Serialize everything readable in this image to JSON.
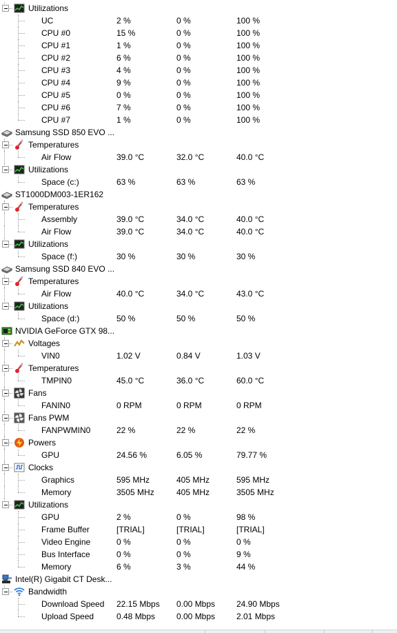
{
  "tree": [
    {
      "level": 1,
      "icon": "utilization-icon",
      "label": "Utilizations"
    },
    {
      "level": 2,
      "label": "UC",
      "values": [
        "2 %",
        "0 %",
        "100 %"
      ]
    },
    {
      "level": 2,
      "label": "CPU #0",
      "values": [
        "15 %",
        "0 %",
        "100 %"
      ]
    },
    {
      "level": 2,
      "label": "CPU #1",
      "values": [
        "1 %",
        "0 %",
        "100 %"
      ]
    },
    {
      "level": 2,
      "label": "CPU #2",
      "values": [
        "6 %",
        "0 %",
        "100 %"
      ]
    },
    {
      "level": 2,
      "label": "CPU #3",
      "values": [
        "4 %",
        "0 %",
        "100 %"
      ]
    },
    {
      "level": 2,
      "label": "CPU #4",
      "values": [
        "9 %",
        "0 %",
        "100 %"
      ]
    },
    {
      "level": 2,
      "label": "CPU #5",
      "values": [
        "0 %",
        "0 %",
        "100 %"
      ]
    },
    {
      "level": 2,
      "label": "CPU #6",
      "values": [
        "7 %",
        "0 %",
        "100 %"
      ]
    },
    {
      "level": 2,
      "label": "CPU #7",
      "values": [
        "1 %",
        "0 %",
        "100 %"
      ]
    },
    {
      "level": 0,
      "icon": "drive-icon",
      "label": "Samsung SSD 850 EVO ..."
    },
    {
      "level": 1,
      "icon": "thermometer-icon",
      "label": "Temperatures"
    },
    {
      "level": 2,
      "label": "Air Flow",
      "values": [
        "39.0 °C",
        "32.0 °C",
        "40.0 °C"
      ]
    },
    {
      "level": 1,
      "icon": "utilization-icon",
      "label": "Utilizations"
    },
    {
      "level": 2,
      "label": "Space (c:)",
      "values": [
        "63 %",
        "63 %",
        "63 %"
      ]
    },
    {
      "level": 0,
      "icon": "drive-icon",
      "label": "ST1000DM003-1ER162"
    },
    {
      "level": 1,
      "icon": "thermometer-icon",
      "label": "Temperatures"
    },
    {
      "level": 2,
      "label": "Assembly",
      "values": [
        "39.0 °C",
        "34.0 °C",
        "40.0 °C"
      ]
    },
    {
      "level": 2,
      "label": "Air Flow",
      "values": [
        "39.0 °C",
        "34.0 °C",
        "40.0 °C"
      ]
    },
    {
      "level": 1,
      "icon": "utilization-icon",
      "label": "Utilizations"
    },
    {
      "level": 2,
      "label": "Space (f:)",
      "values": [
        "30 %",
        "30 %",
        "30 %"
      ]
    },
    {
      "level": 0,
      "icon": "drive-icon",
      "label": "Samsung SSD 840 EVO ..."
    },
    {
      "level": 1,
      "icon": "thermometer-icon",
      "label": "Temperatures"
    },
    {
      "level": 2,
      "label": "Air Flow",
      "values": [
        "40.0 °C",
        "34.0 °C",
        "43.0 °C"
      ]
    },
    {
      "level": 1,
      "icon": "utilization-icon",
      "label": "Utilizations"
    },
    {
      "level": 2,
      "label": "Space (d:)",
      "values": [
        "50 %",
        "50 %",
        "50 %"
      ]
    },
    {
      "level": 0,
      "icon": "gpu-icon",
      "label": "NVIDIA GeForce GTX 98..."
    },
    {
      "level": 1,
      "icon": "voltage-icon",
      "label": "Voltages"
    },
    {
      "level": 2,
      "label": "VIN0",
      "values": [
        "1.02 V",
        "0.84 V",
        "1.03 V"
      ]
    },
    {
      "level": 1,
      "icon": "thermometer-icon",
      "label": "Temperatures"
    },
    {
      "level": 2,
      "label": "TMPIN0",
      "values": [
        "45.0 °C",
        "36.0 °C",
        "60.0 °C"
      ]
    },
    {
      "level": 1,
      "icon": "fan-icon",
      "label": "Fans"
    },
    {
      "level": 2,
      "label": "FANIN0",
      "values": [
        "0 RPM",
        "0 RPM",
        "0 RPM"
      ]
    },
    {
      "level": 1,
      "icon": "fan-pwm-icon",
      "label": "Fans PWM"
    },
    {
      "level": 2,
      "label": "FANPWMIN0",
      "values": [
        "22 %",
        "22 %",
        "22 %"
      ]
    },
    {
      "level": 1,
      "icon": "power-icon",
      "label": "Powers"
    },
    {
      "level": 2,
      "label": "GPU",
      "values": [
        "24.56 %",
        "6.05 %",
        "79.77 %"
      ]
    },
    {
      "level": 1,
      "icon": "clock-icon",
      "label": "Clocks"
    },
    {
      "level": 2,
      "label": "Graphics",
      "values": [
        "595 MHz",
        "405 MHz",
        "595 MHz"
      ]
    },
    {
      "level": 2,
      "label": "Memory",
      "values": [
        "3505 MHz",
        "405 MHz",
        "3505 MHz"
      ]
    },
    {
      "level": 1,
      "icon": "utilization-icon",
      "label": "Utilizations"
    },
    {
      "level": 2,
      "label": "GPU",
      "values": [
        "2 %",
        "0 %",
        "98 %"
      ]
    },
    {
      "level": 2,
      "label": "Frame Buffer",
      "values": [
        "[TRIAL]",
        "[TRIAL]",
        "[TRIAL]"
      ]
    },
    {
      "level": 2,
      "label": "Video Engine",
      "values": [
        "0 %",
        "0 %",
        "0 %"
      ]
    },
    {
      "level": 2,
      "label": "Bus Interface",
      "values": [
        "0 %",
        "0 %",
        "9 %"
      ]
    },
    {
      "level": 2,
      "label": "Memory",
      "values": [
        "6 %",
        "3 %",
        "44 %"
      ]
    },
    {
      "level": 0,
      "icon": "network-adapter-icon",
      "label": "Intel(R) Gigabit CT Desk..."
    },
    {
      "level": 1,
      "icon": "wifi-icon",
      "label": "Bandwidth"
    },
    {
      "level": 2,
      "label": "Download Speed",
      "values": [
        "22.15 Mbps",
        "0.00 Mbps",
        "24.90 Mbps"
      ]
    },
    {
      "level": 2,
      "label": "Upload Speed",
      "values": [
        "0.48 Mbps",
        "0.00 Mbps",
        "2.01 Mbps"
      ]
    }
  ]
}
